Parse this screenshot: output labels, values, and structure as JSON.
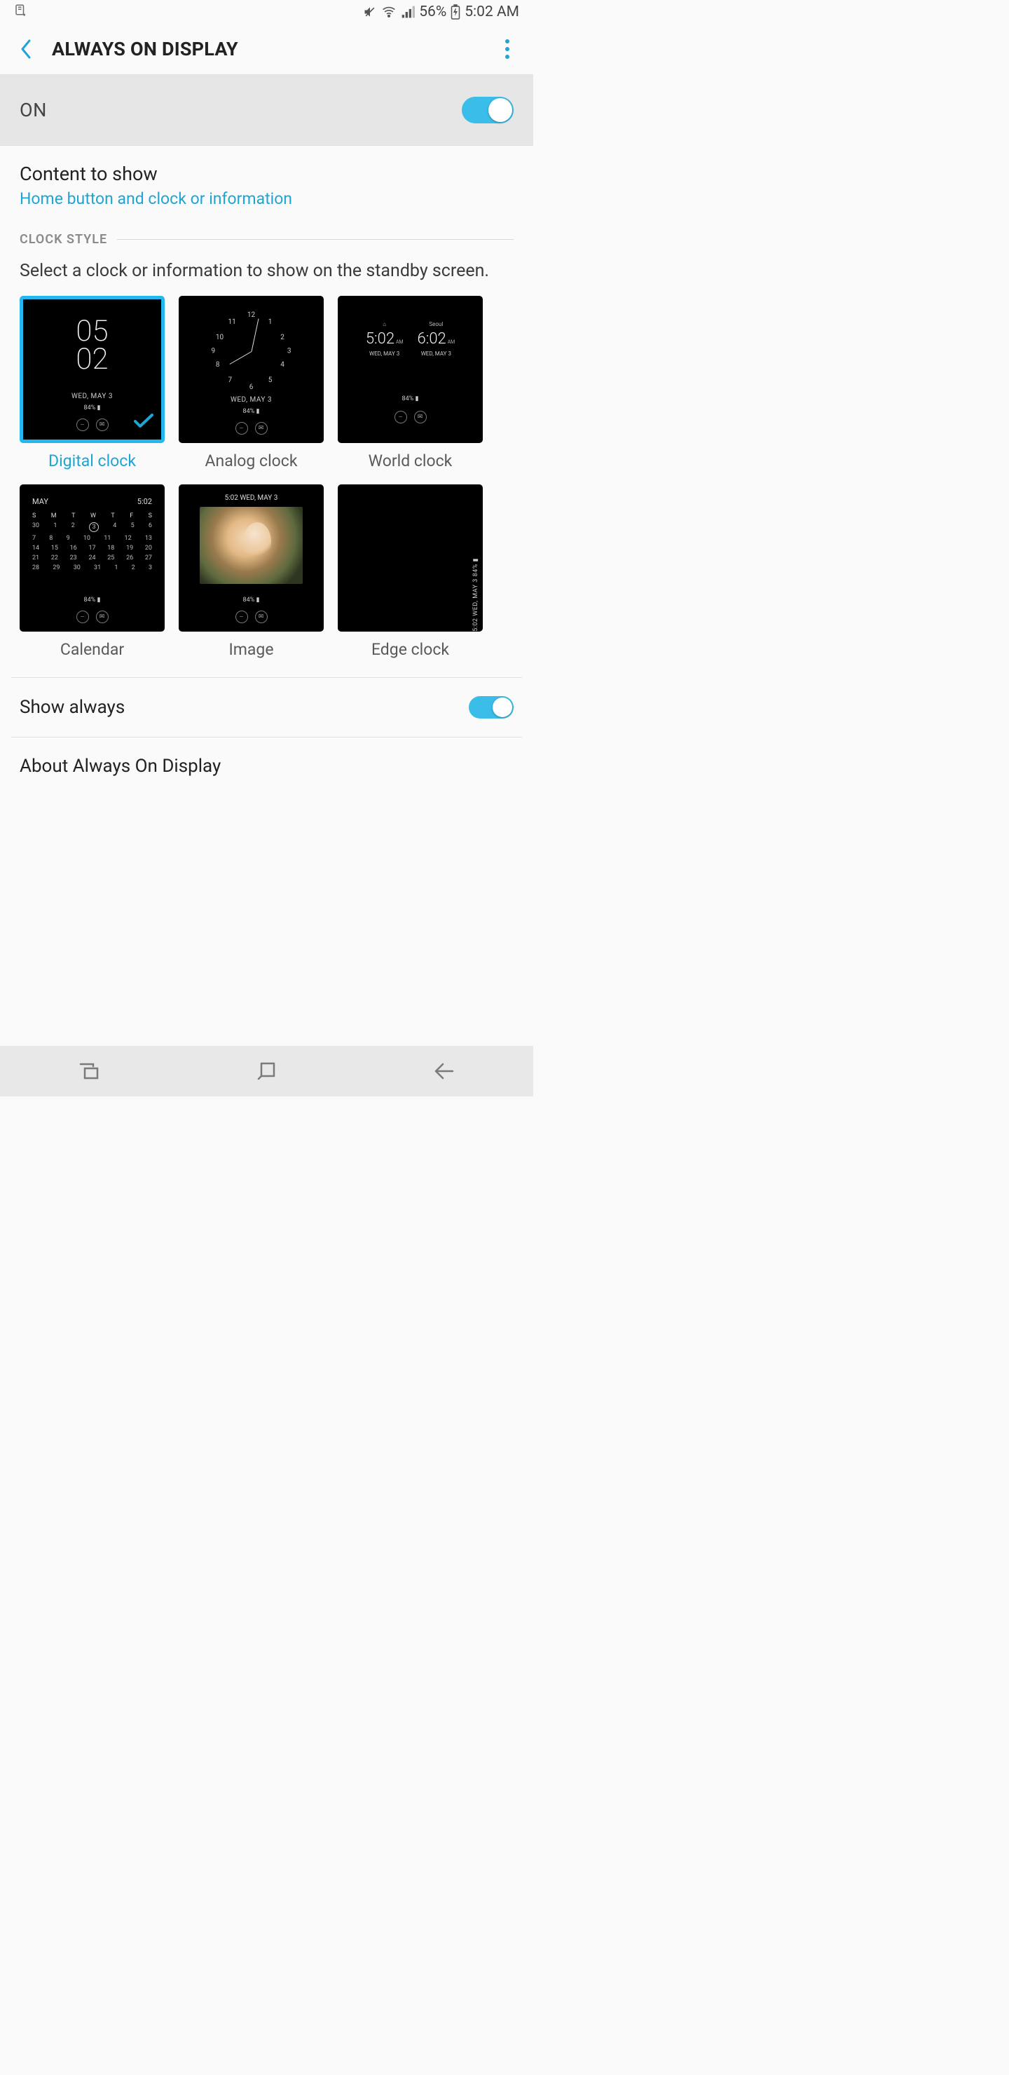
{
  "status": {
    "battery": "56%",
    "time": "5:02 AM"
  },
  "header": {
    "title": "ALWAYS ON DISPLAY"
  },
  "master": {
    "label": "ON",
    "enabled": true
  },
  "content": {
    "title": "Content to show",
    "subtitle": "Home button and clock or information"
  },
  "clock_style": {
    "header": "CLOCK STYLE",
    "description": "Select a clock or information to show on the standby screen.",
    "preview": {
      "date": "WED, MAY 3",
      "battery": "84%",
      "digital_hour": "05",
      "digital_min": "02",
      "world_city_home": "Seoul",
      "world_time1": "5:02",
      "world_time2": "6:02",
      "cal_month": "MAY",
      "cal_time": "5:02",
      "image_header": "5:02 WED, MAY 3",
      "edge_text": "5:02  WED, MAY 3    84% ▮"
    },
    "options": [
      {
        "label": "Digital clock",
        "selected": true
      },
      {
        "label": "Analog clock",
        "selected": false
      },
      {
        "label": "World clock",
        "selected": false
      },
      {
        "label": "Calendar",
        "selected": false
      },
      {
        "label": "Image",
        "selected": false
      },
      {
        "label": "Edge clock",
        "selected": false
      }
    ]
  },
  "settings": {
    "show_always": {
      "label": "Show always",
      "enabled": true
    },
    "about": {
      "label": "About Always On Display"
    }
  }
}
